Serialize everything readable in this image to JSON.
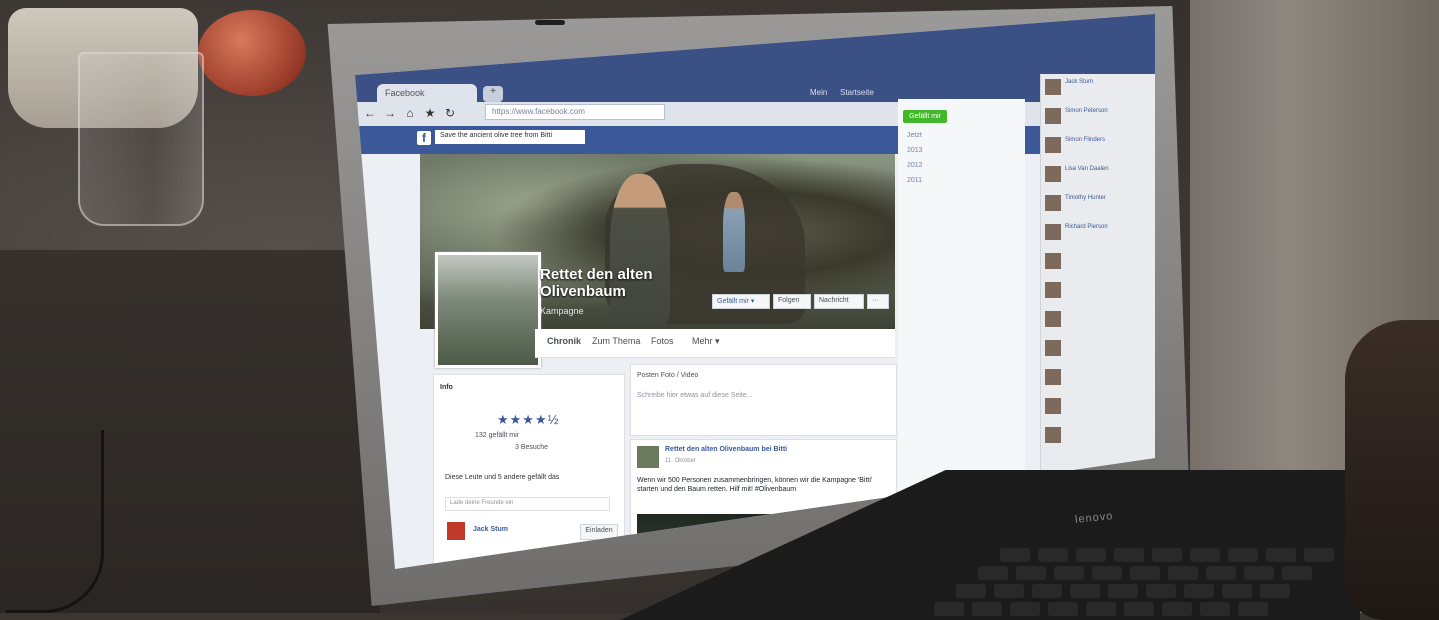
{
  "browser": {
    "tab_title": "Facebook",
    "new_tab": "+",
    "url": "https://www.facebook.com",
    "nav": {
      "back": "←",
      "forward": "→",
      "home": "⌂",
      "star": "★",
      "reload": "↻"
    }
  },
  "facebook": {
    "search_text": "Save the ancient olive tree from Bitti",
    "header_links": [
      "Mein",
      "Startseite"
    ]
  },
  "page": {
    "name": "Rettet den alten Olivenbaum",
    "category": "Kampagne",
    "cover_buttons": {
      "like": "Gefällt mir ▾",
      "follow": "Folgen",
      "message": "Nachricht",
      "more": "···"
    },
    "tabs": [
      "Chronik",
      "Zum Thema",
      "Fotos",
      "Mehr ▾"
    ]
  },
  "about": {
    "heading": "Info",
    "stars": "★★★★½",
    "likes": "132 gefällt mir",
    "visits": "3 Besuche",
    "invite_text": "Diese Leute und 5 andere gefällt das",
    "invite_placeholder": "Lade deine Freunde ein",
    "friend_name": "Jack Stum",
    "invite_button": "Einladen"
  },
  "composer": {
    "tabs": "Posten   Foto / Video",
    "prompt": "Schreibe hier etwas auf diese Seite..."
  },
  "post": {
    "title": "Rettet den alten Olivenbaum bei Bitti",
    "date": "11. Oktober",
    "body": "Wenn wir 500 Personen zusammenbringen, können wir die Kampagne 'Bitti' starten und den Baum retten. Hilf mit! #Olivenbaum"
  },
  "right_rail": {
    "like_cta": "Gefällt mir",
    "years": [
      "Jetzt",
      "2013",
      "2012",
      "2011"
    ]
  },
  "chat": [
    {
      "name": "Jack Stum",
      "note": ""
    },
    {
      "name": "Simon Peterson",
      "note": ""
    },
    {
      "name": "Simon Flinders",
      "note": ""
    },
    {
      "name": "Lisa Van Daalen",
      "note": ""
    },
    {
      "name": "Timothy Hunter",
      "note": ""
    },
    {
      "name": "Richard Pierson",
      "note": ""
    },
    {
      "name": "",
      "note": ""
    },
    {
      "name": "",
      "note": ""
    },
    {
      "name": "",
      "note": ""
    },
    {
      "name": "",
      "note": ""
    },
    {
      "name": "",
      "note": ""
    },
    {
      "name": "",
      "note": ""
    },
    {
      "name": "",
      "note": ""
    }
  ],
  "laptop": {
    "brand": "lenovo"
  },
  "colors": {
    "facebook_blue": "#3b5998",
    "like_green": "#42b72a"
  }
}
